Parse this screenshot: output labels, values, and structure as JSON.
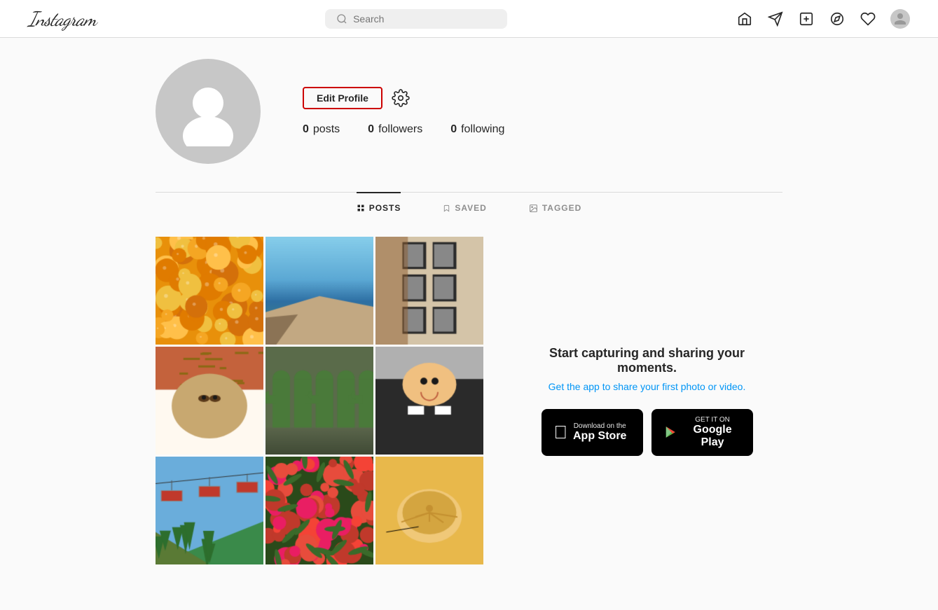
{
  "header": {
    "logo": "Instagram",
    "search_placeholder": "Search",
    "nav_icons": [
      "home",
      "direct",
      "add",
      "explore",
      "heart"
    ]
  },
  "profile": {
    "username": "",
    "posts_count": "0",
    "posts_label": "posts",
    "followers_count": "0",
    "followers_label": "followers",
    "following_count": "0",
    "following_label": "following",
    "edit_profile_label": "Edit Profile"
  },
  "tabs": [
    {
      "id": "posts",
      "label": "POSTS",
      "active": true
    },
    {
      "id": "saved",
      "label": "SAVED",
      "active": false
    },
    {
      "id": "tagged",
      "label": "TAGGED",
      "active": false
    }
  ],
  "promo": {
    "title": "Start capturing and sharing your moments.",
    "subtitle": "Get the app to share your first photo or video.",
    "app_store_line1": "Download on the",
    "app_store_line2": "App Store",
    "google_play_line1": "GET IT ON",
    "google_play_line2": "Google Play"
  }
}
